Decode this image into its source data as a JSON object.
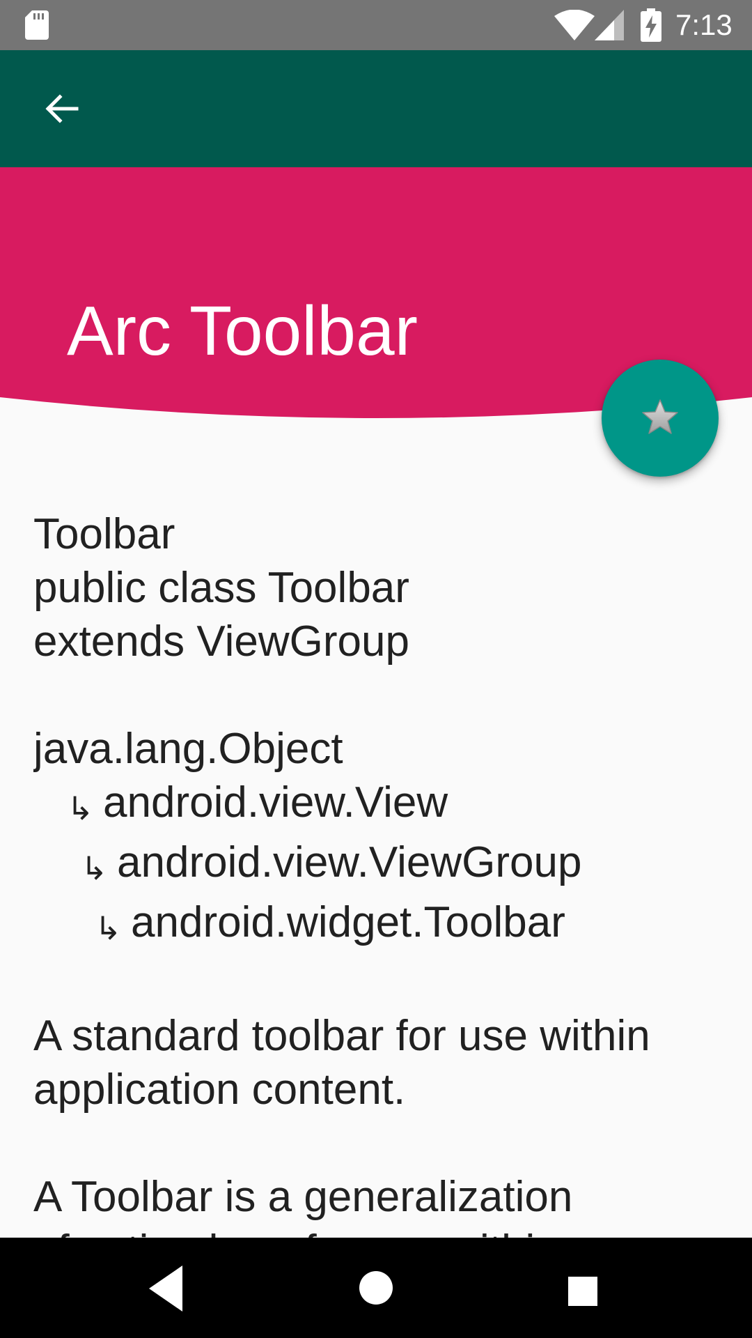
{
  "status_bar": {
    "time": "7:13",
    "icons": [
      "sd-card-icon",
      "wifi-icon",
      "cell-signal-icon",
      "battery-charging-icon"
    ]
  },
  "action_bar": {
    "back_icon": "arrow-back-icon",
    "background_color": "#01594D"
  },
  "header": {
    "title": "Arc Toolbar",
    "background_color": "#D81B60"
  },
  "fab": {
    "icon": "star-icon",
    "background_color": "#009688"
  },
  "content": {
    "heading": "Toolbar",
    "declaration_1": "public class Toolbar",
    "declaration_2": "extends ViewGroup",
    "hierarchy": [
      {
        "level": 0,
        "arrow": "",
        "name": "java.lang.Object"
      },
      {
        "level": 1,
        "arrow": "↳",
        "name": "android.view.View"
      },
      {
        "level": 2,
        "arrow": "↳",
        "name": "android.view.ViewGroup"
      },
      {
        "level": 3,
        "arrow": "↳",
        "name": "android.widget.Toolbar"
      }
    ],
    "paragraph_1_line_1": "A standard toolbar for use within",
    "paragraph_1_line_2": "application content.",
    "paragraph_2_line_1": "A Toolbar is a generalization",
    "paragraph_2_line_2": "of action bars for use within"
  },
  "nav_bar": {
    "icons": [
      "nav-back-icon",
      "nav-home-icon",
      "nav-recents-icon"
    ]
  }
}
